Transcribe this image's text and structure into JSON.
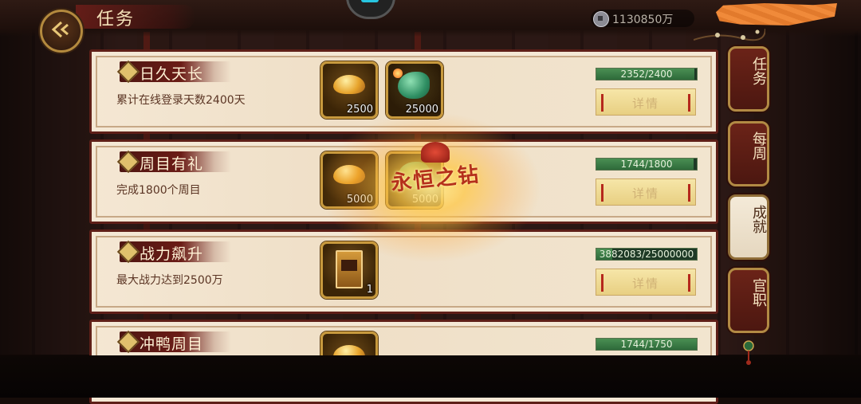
{
  "header": {
    "title": "任务",
    "currency_value": "1130850万",
    "user_name": ""
  },
  "tasks": [
    {
      "name": "日久天长",
      "desc": "累计在线登录天数2400天",
      "rewards": [
        {
          "icon": "gold-ingot-icon",
          "count": "2500"
        },
        {
          "icon": "jade-icon",
          "count": "25000"
        }
      ],
      "progress_text": "2352/2400",
      "progress_fraction": 0.98,
      "button_label": "详情"
    },
    {
      "name": "周目有礼",
      "desc": "完成1800个周目",
      "rewards": [
        {
          "icon": "gold-ingot-icon",
          "count": "5000"
        },
        {
          "icon": "jade-icon",
          "count": "5000"
        }
      ],
      "progress_text": "1744/1800",
      "progress_fraction": 0.969,
      "button_label": "详情"
    },
    {
      "name": "战力飙升",
      "desc": "最大战力达到2500万",
      "rewards": [
        {
          "icon": "title-book-icon",
          "count": "1"
        }
      ],
      "progress_text": "3882083/25000000",
      "progress_fraction": 0.155,
      "button_label": "详情"
    },
    {
      "name": "冲鸭周目",
      "desc": "",
      "rewards": [
        {
          "icon": "gold-ingot-icon",
          "count": ""
        }
      ],
      "progress_text": "1744/1750",
      "progress_fraction": 0.997,
      "button_label": "详情"
    }
  ],
  "side_tabs": [
    {
      "label": "任务",
      "active": false
    },
    {
      "label": "每周",
      "active": false
    },
    {
      "label": "成就",
      "active": true
    },
    {
      "label": "官职",
      "active": false
    }
  ],
  "overlay": {
    "emblem_text": "永恒之钻"
  },
  "colors": {
    "card_bg": "#f4e7d3",
    "card_border": "#5e1f18",
    "progress_fill": "#2e6a3a",
    "button_bg": "#f6e6a8",
    "tab_bg": "#6b2318"
  }
}
